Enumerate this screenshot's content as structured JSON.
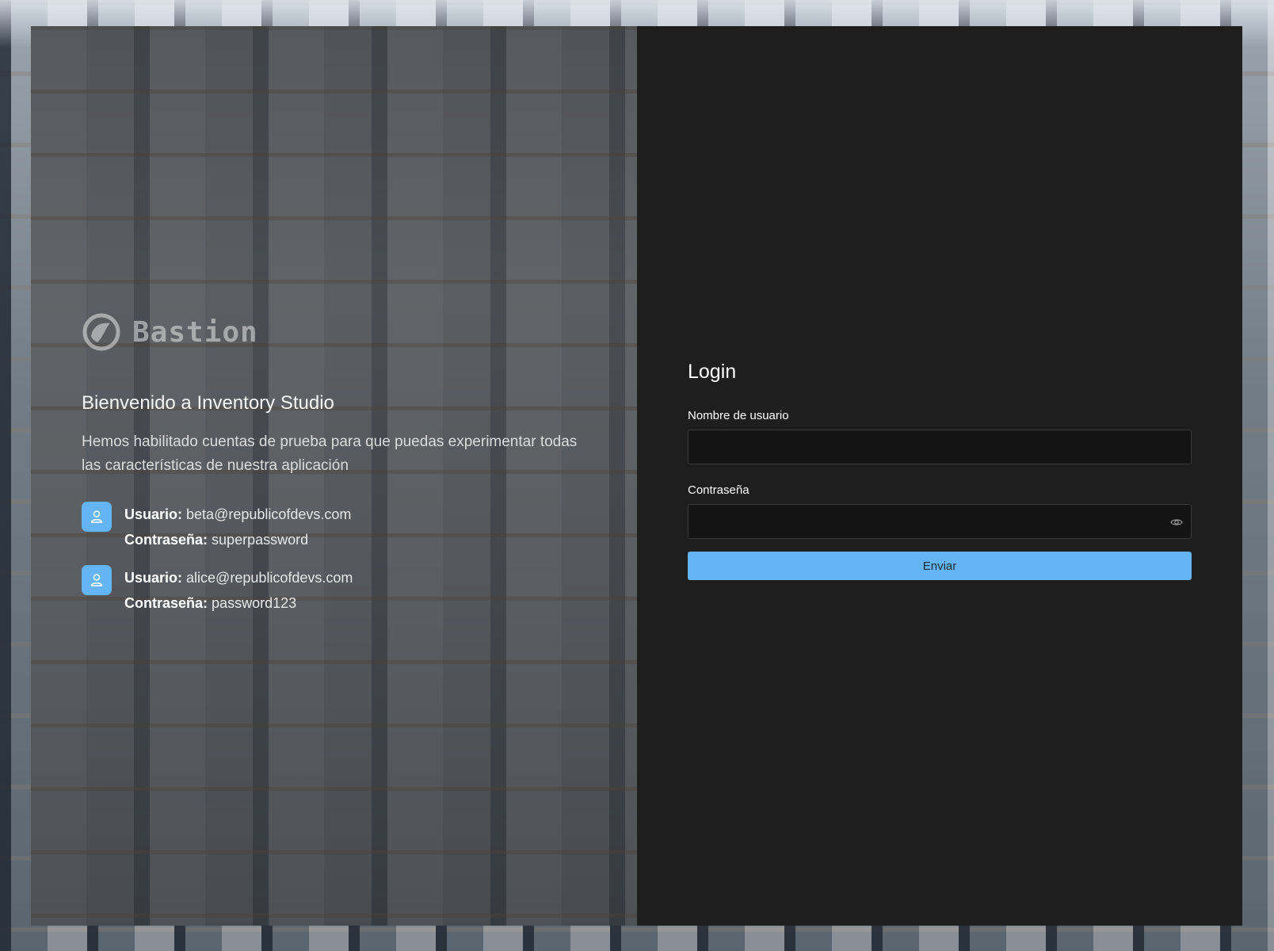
{
  "brand": {
    "logo_text": "Bastion"
  },
  "welcome": {
    "title": "Bienvenido a Inventory Studio",
    "subtitle": "Hemos habilitado cuentas de prueba para que puedas experimentar todas las características de nuestra aplicación"
  },
  "demo_accounts": [
    {
      "user_label": "Usuario:",
      "user_value": "beta@republicofdevs.com",
      "password_label": "Contraseña:",
      "password_value": "superpassword",
      "icon": "user-icon"
    },
    {
      "user_label": "Usuario:",
      "user_value": "alice@republicofdevs.com",
      "password_label": "Contraseña:",
      "password_value": "password123",
      "icon": "user-icon"
    }
  ],
  "login": {
    "title": "Login",
    "username_label": "Nombre de usuario",
    "username_value": "",
    "password_label": "Contraseña",
    "password_value": "",
    "password_toggle_icon": "eye-icon",
    "submit_label": "Enviar"
  },
  "colors": {
    "accent": "#64b5f6",
    "panel_bg": "#1e1e1e",
    "input_bg": "#141414"
  }
}
